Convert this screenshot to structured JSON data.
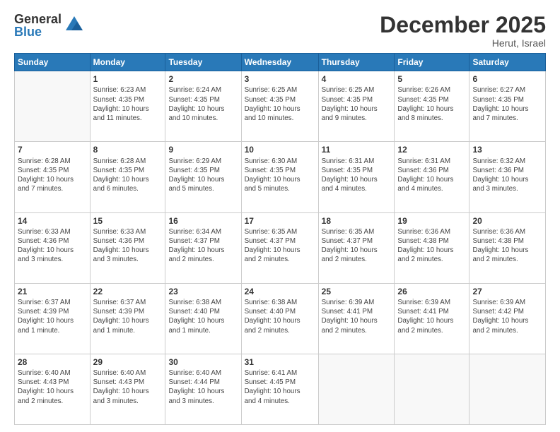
{
  "logo": {
    "general": "General",
    "blue": "Blue"
  },
  "title": "December 2025",
  "location": "Herut, Israel",
  "headers": [
    "Sunday",
    "Monday",
    "Tuesday",
    "Wednesday",
    "Thursday",
    "Friday",
    "Saturday"
  ],
  "weeks": [
    [
      {
        "day": "",
        "info": ""
      },
      {
        "day": "1",
        "info": "Sunrise: 6:23 AM\nSunset: 4:35 PM\nDaylight: 10 hours\nand 11 minutes."
      },
      {
        "day": "2",
        "info": "Sunrise: 6:24 AM\nSunset: 4:35 PM\nDaylight: 10 hours\nand 10 minutes."
      },
      {
        "day": "3",
        "info": "Sunrise: 6:25 AM\nSunset: 4:35 PM\nDaylight: 10 hours\nand 10 minutes."
      },
      {
        "day": "4",
        "info": "Sunrise: 6:25 AM\nSunset: 4:35 PM\nDaylight: 10 hours\nand 9 minutes."
      },
      {
        "day": "5",
        "info": "Sunrise: 6:26 AM\nSunset: 4:35 PM\nDaylight: 10 hours\nand 8 minutes."
      },
      {
        "day": "6",
        "info": "Sunrise: 6:27 AM\nSunset: 4:35 PM\nDaylight: 10 hours\nand 7 minutes."
      }
    ],
    [
      {
        "day": "7",
        "info": "Sunrise: 6:28 AM\nSunset: 4:35 PM\nDaylight: 10 hours\nand 7 minutes."
      },
      {
        "day": "8",
        "info": "Sunrise: 6:28 AM\nSunset: 4:35 PM\nDaylight: 10 hours\nand 6 minutes."
      },
      {
        "day": "9",
        "info": "Sunrise: 6:29 AM\nSunset: 4:35 PM\nDaylight: 10 hours\nand 5 minutes."
      },
      {
        "day": "10",
        "info": "Sunrise: 6:30 AM\nSunset: 4:35 PM\nDaylight: 10 hours\nand 5 minutes."
      },
      {
        "day": "11",
        "info": "Sunrise: 6:31 AM\nSunset: 4:35 PM\nDaylight: 10 hours\nand 4 minutes."
      },
      {
        "day": "12",
        "info": "Sunrise: 6:31 AM\nSunset: 4:36 PM\nDaylight: 10 hours\nand 4 minutes."
      },
      {
        "day": "13",
        "info": "Sunrise: 6:32 AM\nSunset: 4:36 PM\nDaylight: 10 hours\nand 3 minutes."
      }
    ],
    [
      {
        "day": "14",
        "info": "Sunrise: 6:33 AM\nSunset: 4:36 PM\nDaylight: 10 hours\nand 3 minutes."
      },
      {
        "day": "15",
        "info": "Sunrise: 6:33 AM\nSunset: 4:36 PM\nDaylight: 10 hours\nand 3 minutes."
      },
      {
        "day": "16",
        "info": "Sunrise: 6:34 AM\nSunset: 4:37 PM\nDaylight: 10 hours\nand 2 minutes."
      },
      {
        "day": "17",
        "info": "Sunrise: 6:35 AM\nSunset: 4:37 PM\nDaylight: 10 hours\nand 2 minutes."
      },
      {
        "day": "18",
        "info": "Sunrise: 6:35 AM\nSunset: 4:37 PM\nDaylight: 10 hours\nand 2 minutes."
      },
      {
        "day": "19",
        "info": "Sunrise: 6:36 AM\nSunset: 4:38 PM\nDaylight: 10 hours\nand 2 minutes."
      },
      {
        "day": "20",
        "info": "Sunrise: 6:36 AM\nSunset: 4:38 PM\nDaylight: 10 hours\nand 2 minutes."
      }
    ],
    [
      {
        "day": "21",
        "info": "Sunrise: 6:37 AM\nSunset: 4:39 PM\nDaylight: 10 hours\nand 1 minute."
      },
      {
        "day": "22",
        "info": "Sunrise: 6:37 AM\nSunset: 4:39 PM\nDaylight: 10 hours\nand 1 minute."
      },
      {
        "day": "23",
        "info": "Sunrise: 6:38 AM\nSunset: 4:40 PM\nDaylight: 10 hours\nand 1 minute."
      },
      {
        "day": "24",
        "info": "Sunrise: 6:38 AM\nSunset: 4:40 PM\nDaylight: 10 hours\nand 2 minutes."
      },
      {
        "day": "25",
        "info": "Sunrise: 6:39 AM\nSunset: 4:41 PM\nDaylight: 10 hours\nand 2 minutes."
      },
      {
        "day": "26",
        "info": "Sunrise: 6:39 AM\nSunset: 4:41 PM\nDaylight: 10 hours\nand 2 minutes."
      },
      {
        "day": "27",
        "info": "Sunrise: 6:39 AM\nSunset: 4:42 PM\nDaylight: 10 hours\nand 2 minutes."
      }
    ],
    [
      {
        "day": "28",
        "info": "Sunrise: 6:40 AM\nSunset: 4:43 PM\nDaylight: 10 hours\nand 2 minutes."
      },
      {
        "day": "29",
        "info": "Sunrise: 6:40 AM\nSunset: 4:43 PM\nDaylight: 10 hours\nand 3 minutes."
      },
      {
        "day": "30",
        "info": "Sunrise: 6:40 AM\nSunset: 4:44 PM\nDaylight: 10 hours\nand 3 minutes."
      },
      {
        "day": "31",
        "info": "Sunrise: 6:41 AM\nSunset: 4:45 PM\nDaylight: 10 hours\nand 4 minutes."
      },
      {
        "day": "",
        "info": ""
      },
      {
        "day": "",
        "info": ""
      },
      {
        "day": "",
        "info": ""
      }
    ]
  ]
}
